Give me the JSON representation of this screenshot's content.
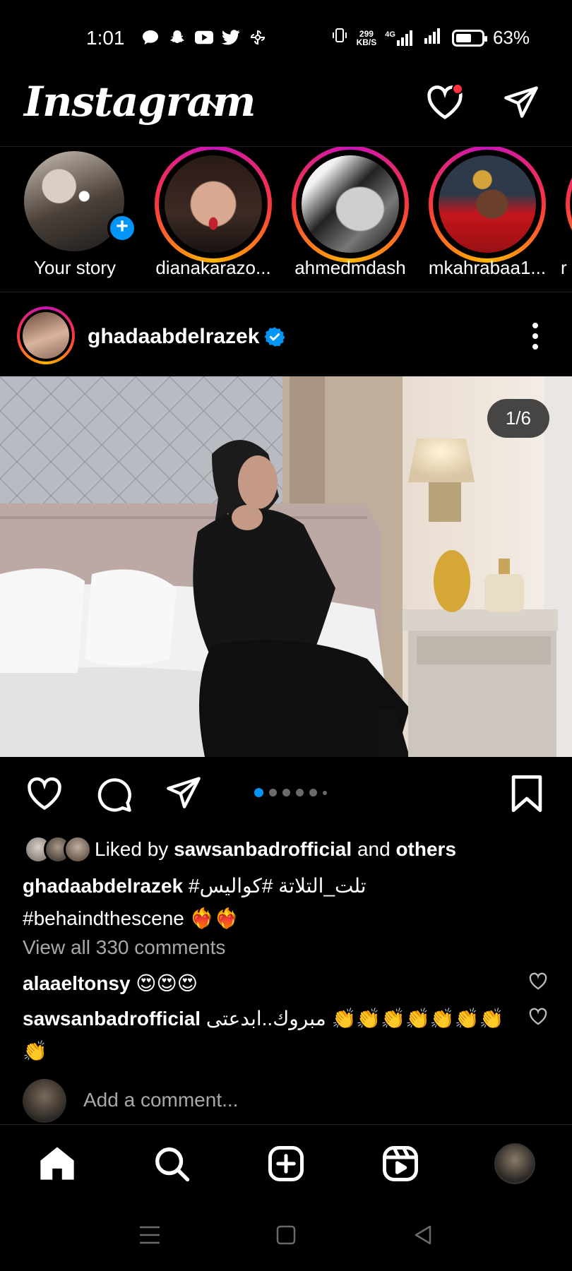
{
  "status_bar": {
    "time": "1:01",
    "app_icons": [
      "chat-bubble-icon",
      "snapchat-icon",
      "youtube-icon",
      "twitter-icon",
      "pinwheel-icon"
    ],
    "speed_value": "299",
    "speed_unit": "KB/S",
    "network": "4G",
    "battery_percent": "63%",
    "battery_level": 0.63
  },
  "header": {
    "logo": "Instagram",
    "notification_dot_color": "#ff3040"
  },
  "stories": [
    {
      "name": "Your story",
      "own": true
    },
    {
      "name": "dianakarazo..."
    },
    {
      "name": "ahmedmdash"
    },
    {
      "name": "mkahrabaa1..."
    },
    {
      "name": "r"
    }
  ],
  "post": {
    "username": "ghadaabdelrazek",
    "verified": true,
    "counter": "1/6",
    "carousel": {
      "current": 1,
      "total": 6,
      "visible_dots": 6
    },
    "liked_prefix": "Liked by ",
    "liked_user": "sawsanbadrofficial",
    "liked_and": " and ",
    "liked_others": "others",
    "caption_user": "ghadaabdelrazek",
    "caption_text": " #تلت_التلاتة #كواليس",
    "caption_line2": "#behaindthescene ❤️‍🔥❤️‍🔥",
    "view_all": "View all 330 comments",
    "comments": [
      {
        "user": "alaaeltonsy",
        "text": " 😍😍😍"
      },
      {
        "user": "sawsanbadrofficial",
        "text": " مبروك..ابدعتى 👏👏👏👏👏👏👏👏"
      }
    ],
    "add_comment_placeholder": "Add a comment..."
  },
  "colors": {
    "accent": "#0095f6",
    "background": "#000000",
    "muted_text": "#a8a8a8"
  }
}
